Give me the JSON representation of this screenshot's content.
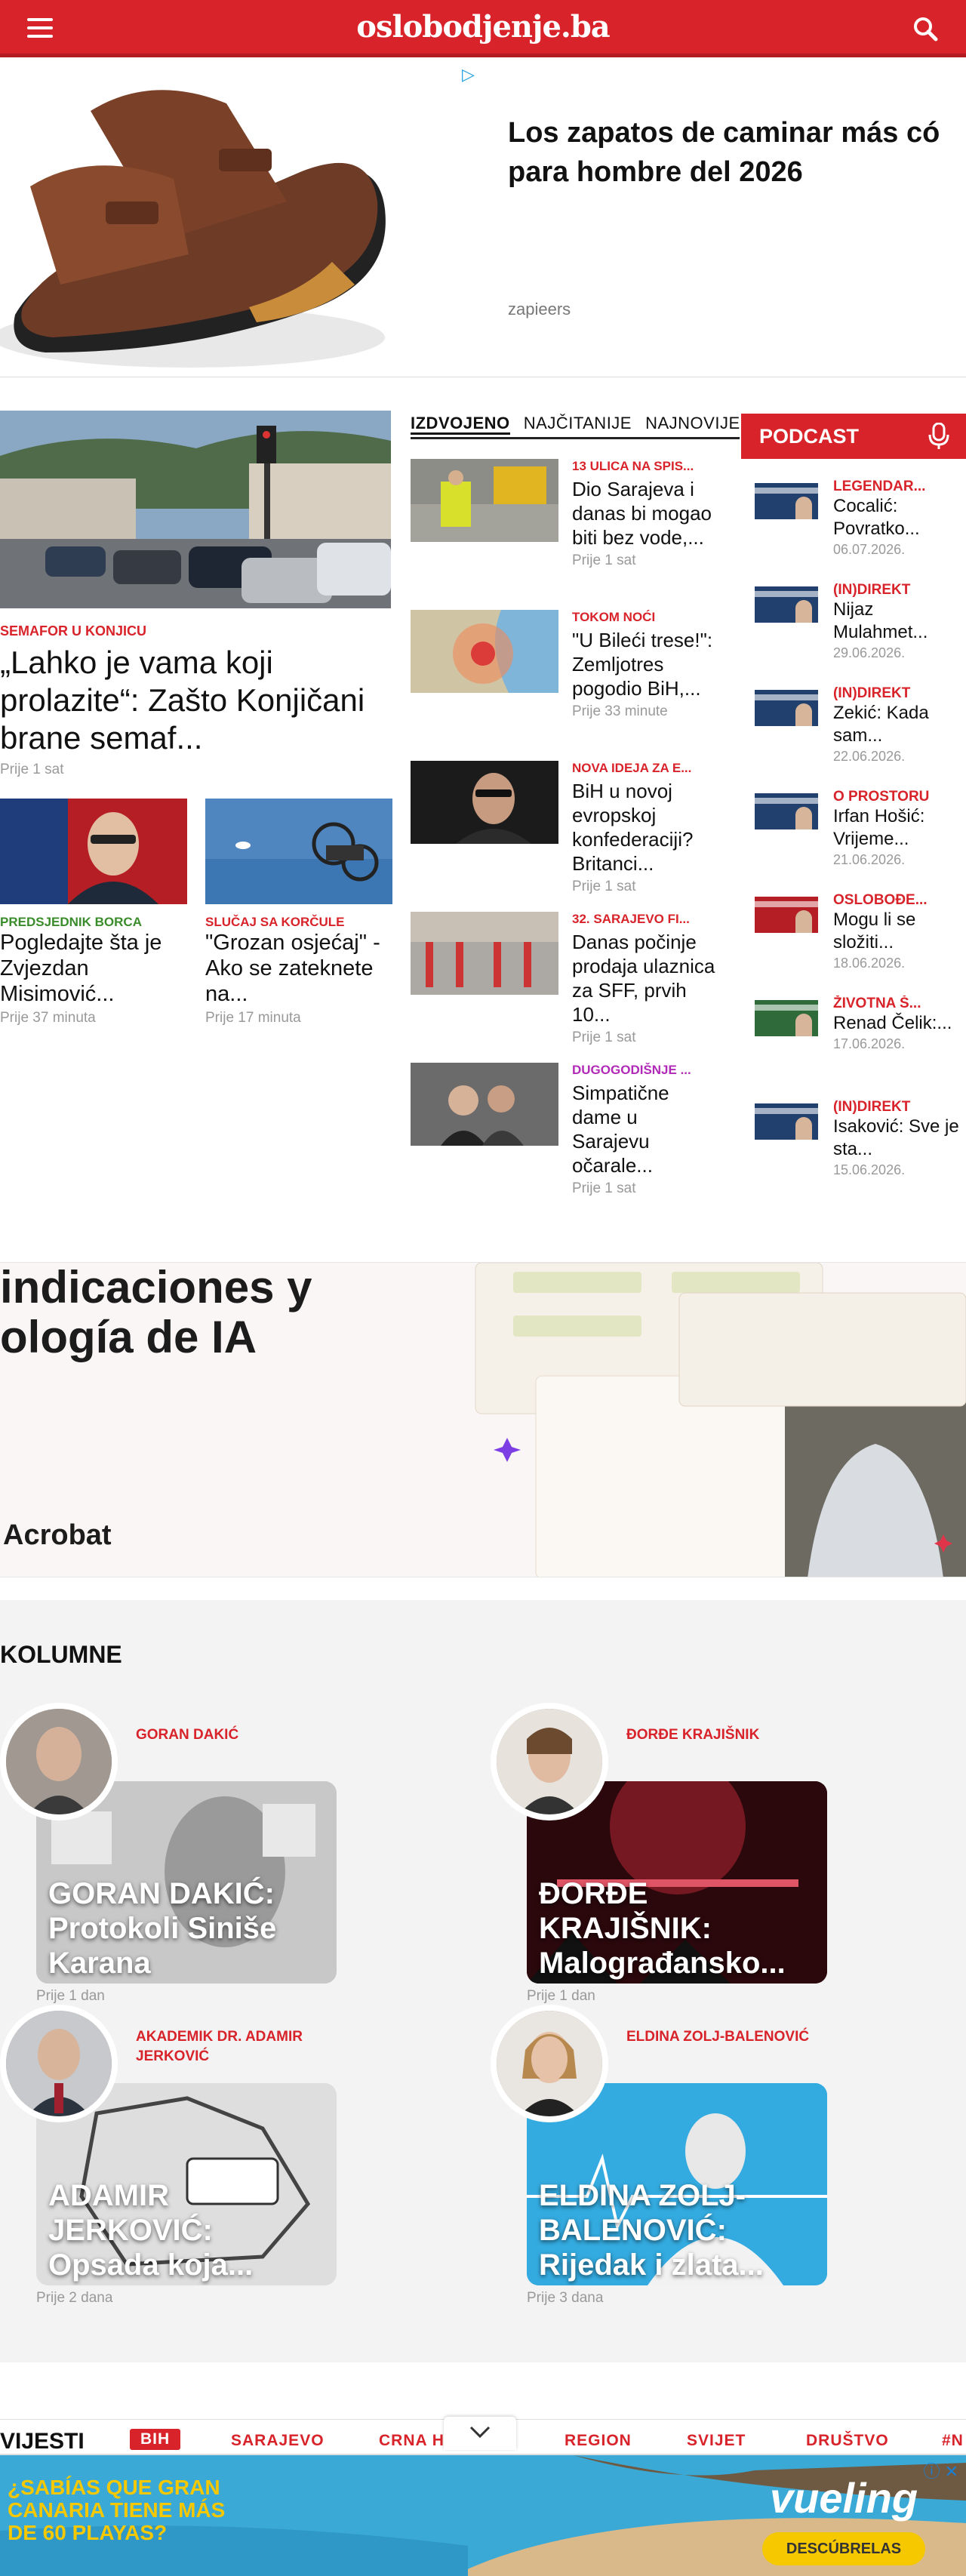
{
  "header": {
    "logo": "oslobodjenje.ba",
    "menu_icon": "hamburger-icon",
    "search_icon": "search-icon",
    "color": "#d8232a"
  },
  "ad_top": {
    "headline_line1": "Los zapatos de caminar más có",
    "headline_line2": "para hombre del 2026",
    "brand": "zapieers",
    "adchoice": "▷"
  },
  "lead": {
    "category": "SEMAFOR U KONJICU",
    "title": "„Lahko je vama koji prolazite“: Zašto Konjičani brane semaf...",
    "time": "Prije 1 sat"
  },
  "sub_stories": [
    {
      "category": "PREDSJEDNIK BORCA",
      "title": "Pogledajte šta je Zvjezdan Misimović...",
      "time": "Prije 37 minuta"
    },
    {
      "category": "SLUČAJ SA KORČULE",
      "title": "\"Grozan osjećaj\" - Ako se zateknete na...",
      "time": "Prije 17 minuta"
    }
  ],
  "tabs": [
    "IZDVOJENO",
    "NAJČITANIJE",
    "NAJNOVIJE"
  ],
  "featured": [
    {
      "category": "13 ULICA NA SPIS...",
      "title": "Dio Sarajeva i danas bi mogao biti bez vode,...",
      "time": "Prije 1 sat"
    },
    {
      "category": "TOKOM NOĆI",
      "title": "\"U Bileći trese!\": Zemljotres pogodio BiH,...",
      "time": "Prije 33 minute"
    },
    {
      "category": "NOVA IDEJA ZA E...",
      "title": "BiH u novoj evropskoj konfederaciji? Britanci...",
      "time": "Prije 1 sat"
    },
    {
      "category": "32. SARAJEVO FI...",
      "title": "Danas počinje prodaja ulaznica za SFF, prvih 10...",
      "time": "Prije 1 sat"
    },
    {
      "category": "DUGOGODIŠNJE ...",
      "title": "Simpatične dame u Sarajevu očarale...",
      "time": "Prije 1 sat"
    }
  ],
  "podcast": {
    "title": "PODCAST",
    "items": [
      {
        "category": "LEGENDAR...",
        "title": "Cocalić: Povratko...",
        "date": "06.07.2026."
      },
      {
        "category": "(IN)DIREKT",
        "title": "Nijaz Mulahmet...",
        "date": "29.06.2026."
      },
      {
        "category": "(IN)DIREKT",
        "title": "Zekić: Kada sam...",
        "date": "22.06.2026."
      },
      {
        "category": "O PROSTORU",
        "title": "Irfan Hošić: Vrijeme...",
        "date": "21.06.2026."
      },
      {
        "category": "OSLOBOĐE...",
        "title": "Mogu li se složiti...",
        "date": "18.06.2026."
      },
      {
        "category": "ŽIVOTNA Š...",
        "title": "Renad Čelik:...",
        "date": "17.06.2026."
      },
      {
        "category": "(IN)DIREKT",
        "title": "Isaković: Sve je sta...",
        "date": "15.06.2026."
      }
    ]
  },
  "ad_mid": {
    "line1": "indicaciones y",
    "line2": "ología de IA",
    "brand": "Acrobat"
  },
  "kolumne": {
    "title": "KOLUMNE",
    "items": [
      {
        "author": "GORAN DAKIĆ",
        "title": "GORAN DAKIĆ: Protokoli Siniše Karana",
        "time": "Prije 1 dan"
      },
      {
        "author": "ĐORĐE KRAJIŠNIK",
        "title": "ĐORĐE KRAJIŠNIK: Malograđansko...",
        "time": "Prije 1 dan"
      },
      {
        "author": "AKADEMIK DR. ADAMIR JERKOVIĆ",
        "title": "ADAMIR JERKOVIĆ: Opsada koja...",
        "time": "Prije 2 dana"
      },
      {
        "author": "ELDINA ZOLJ-BALENOVIĆ",
        "title": "ELDINA ZOLJ-BALENOVIĆ: Rijedak i zlata...",
        "time": "Prije 3 dana"
      }
    ]
  },
  "vijesti_nav": {
    "label": "VIJESTI",
    "items": [
      "BIH",
      "SARAJEVO",
      "CRNA HORA",
      "REGION",
      "SVIJET",
      "DRUŠTVO",
      "#N"
    ]
  },
  "ad_bottom": {
    "text": "¿SABÍAS QUE GRAN CANARIA TIENE MÁS DE 60 PLAYAS?",
    "brand": "vueling",
    "cta": "DESCÚBRELAS",
    "info": "ⓘ ✕"
  }
}
